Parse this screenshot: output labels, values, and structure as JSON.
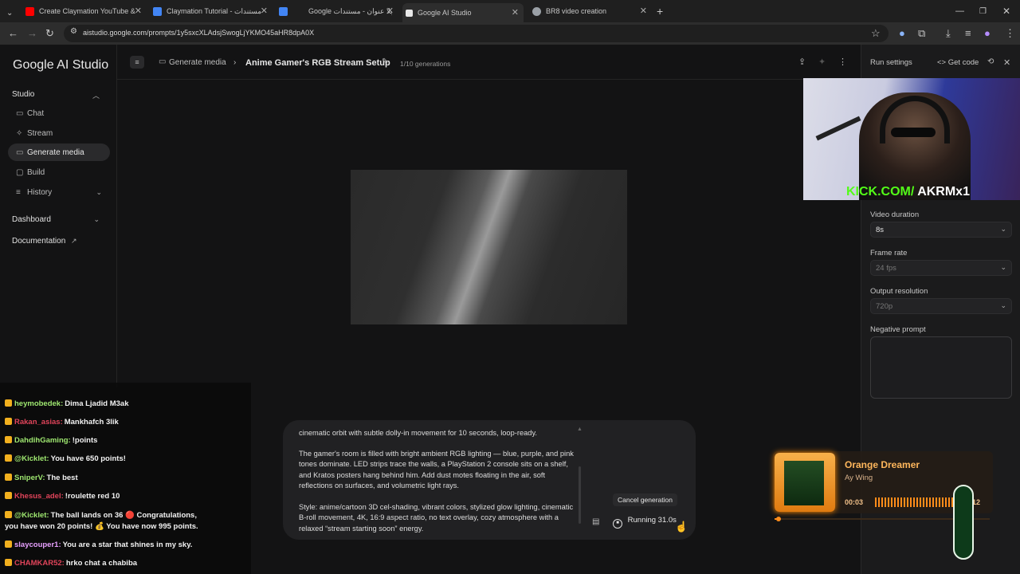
{
  "browser": {
    "tabs": [
      {
        "title": "Create Claymation YouTube &",
        "favicon_color": "#ff0000"
      },
      {
        "title": "Claymation Tutorial - مستندات",
        "favicon_color": "#4285f4"
      },
      {
        "title": "Google بلا عنوان - مستندات",
        "favicon_color": "#4285f4"
      },
      {
        "title": "Google AI Studio",
        "favicon_color": "#e8e8e8"
      },
      {
        "title": "BR8 video creation",
        "favicon_color": "#9aa0a6"
      }
    ],
    "url": "aistudio.google.com/prompts/1y5sxcXLAdsjSwogLjYKMO45aHR8dpA0X"
  },
  "sidebar": {
    "logo": "Google AI Studio",
    "studio_label": "Studio",
    "items": [
      {
        "label": "Chat",
        "icon": "chat-icon"
      },
      {
        "label": "Stream",
        "icon": "stream-icon"
      },
      {
        "label": "Generate media",
        "icon": "media-icon"
      },
      {
        "label": "Build",
        "icon": "build-icon"
      },
      {
        "label": "History",
        "icon": "history-icon"
      }
    ],
    "dashboard_label": "Dashboard",
    "documentation_label": "Documentation"
  },
  "header": {
    "breadcrumb": "Generate media",
    "title": "Anime Gamer's RGB Stream Setup",
    "generations": "1/10 generations"
  },
  "right_panel": {
    "run_settings": "Run settings",
    "get_code": "Get code",
    "video_duration_label": "Video duration",
    "video_duration_value": "8s",
    "frame_rate_label": "Frame rate",
    "frame_rate_value": "24 fps",
    "output_resolution_label": "Output resolution",
    "output_resolution_value": "720p",
    "negative_prompt_label": "Negative prompt"
  },
  "webcam": {
    "overlay_prefix": "KICK.COM/",
    "overlay_handle": "AKRMx1"
  },
  "chat": [
    {
      "user": "heymobedek:",
      "msg": "Dima Ljadid M3ak",
      "color": "#9fe870"
    },
    {
      "user": "Rakan_asias:",
      "msg": "Mankhafch 3lik",
      "color": "#e0445a"
    },
    {
      "user": "DahdihGaming:",
      "msg": "!points",
      "color": "#9fe870"
    },
    {
      "user": "@Kicklet:",
      "msg": "You have 650 points!",
      "color": "#9fe870"
    },
    {
      "user": "SniperV:",
      "msg": "The best",
      "color": "#9fe870"
    },
    {
      "user": "Khesus_adel:",
      "msg": "!roulette red 10",
      "color": "#e0445a"
    },
    {
      "user": "@Kicklet:",
      "msg": "The ball lands on 36 🔴 Congratulations,",
      "color": "#9fe870"
    },
    {
      "user": "",
      "msg": "you have won 20 points! 💰 You have now 995 points.",
      "color": "#9fe870"
    },
    {
      "user": "slaycouper1:",
      "msg": "You are a star that shines in my sky.",
      "color": "#e8a0ff"
    },
    {
      "user": "CHAMKAR52:",
      "msg": "hrko chat a chabiba",
      "color": "#e0445a"
    }
  ],
  "prompt": {
    "para1": "cinematic orbit with subtle dolly-in movement for 10 seconds, loop-ready.",
    "para2": "The gamer's room is filled with bright ambient RGB lighting — blue, purple, and pink tones dominate. LED strips trace the walls, a PlayStation 2 console sits on a shelf, and Kratos posters hang behind him. Add dust motes floating in the air, soft reflections on surfaces, and volumetric light rays.",
    "para3": "Style: anime/cartoon 3D cel-shading, vibrant colors, stylized glow lighting, cinematic B-roll movement, 4K, 16:9 aspect ratio, no text overlay, cozy atmosphere with a relaxed “stream starting soon” energy.",
    "cancel_tooltip": "Cancel generation",
    "running": "Running 31.0s"
  },
  "music": {
    "song": "Orange Dreamer",
    "artist": "Ay Wing",
    "elapsed": "00:03",
    "total": "3:12",
    "progress": 0.02,
    "accent": "#ff8c1a"
  }
}
